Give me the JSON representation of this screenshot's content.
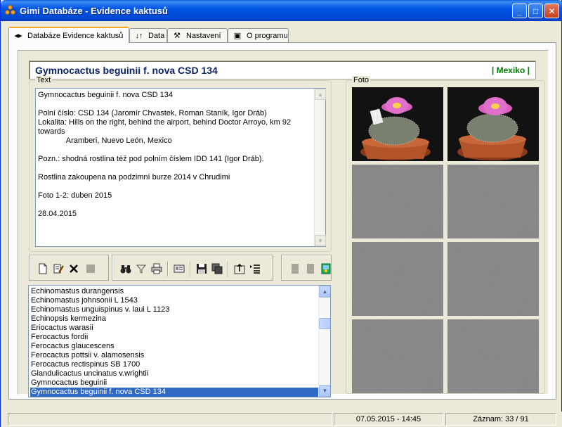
{
  "window": {
    "title": "Gimi Databáze - Evidence kaktusů",
    "controls": {
      "minimize": "_",
      "maximize": "□",
      "close": "✕"
    }
  },
  "tabs": [
    {
      "label": "Databáze Evidence kaktusů",
      "icon": "left-right-arrows-icon",
      "glyph": "◂▸"
    },
    {
      "label": "Data",
      "icon": "sort-arrows-icon",
      "glyph": "↓↑"
    },
    {
      "label": "Nastavení",
      "icon": "tools-icon",
      "glyph": "⚒"
    },
    {
      "label": "O programu",
      "icon": "info-box-icon",
      "glyph": "▣"
    }
  ],
  "header": {
    "species": "Gymnocactus beguinii f. nova CSD 134",
    "origin": "| Mexiko |"
  },
  "text_group": {
    "label": "Text",
    "content": "Gymnocactus beguinii f. nova CSD 134\n\nPolní číslo: CSD 134 (Jaromír Chvastek, Roman Staník, Igor Dráb)\nLokalita: Hills on the right, behind the airport, behind Doctor Arroyo, km 92 towards\n             Aramberi, Nuevo León, Mexico\n\nPozn.: shodná rostlina též pod polním číslem IDD 141 (Igor Dráb).\n\nRostlina zakoupena na podzimní burze 2014 v Chrudimi\n\nFoto 1-2: duben 2015\n\n28.04.2015"
  },
  "photo_group": {
    "label": "Foto"
  },
  "list": {
    "items": [
      "Echinomastus durangensis",
      "Echinomastus johnsonii L 1543",
      "Echinomastus unguispinus v. laui L 1123",
      "Echinopsis kermezina",
      "Eriocactus warasii",
      "Ferocactus fordii",
      "Ferocactus glaucescens",
      "Ferocactus pottsii v. alamosensis",
      "Ferocactus rectispinus SB 1700",
      "Glandulicactus uncinatus v.wrightii",
      "Gymnocactus beguinii",
      "Gymnocactus beguinii f. nova CSD 134"
    ],
    "selected_index": 11
  },
  "status": {
    "datetime": "07.05.2015 - 14:45",
    "record": "Záznam: 33 / 91"
  },
  "colors": {
    "title_blue": "#0a246a",
    "origin_green": "#008000",
    "selection": "#316ac5"
  }
}
